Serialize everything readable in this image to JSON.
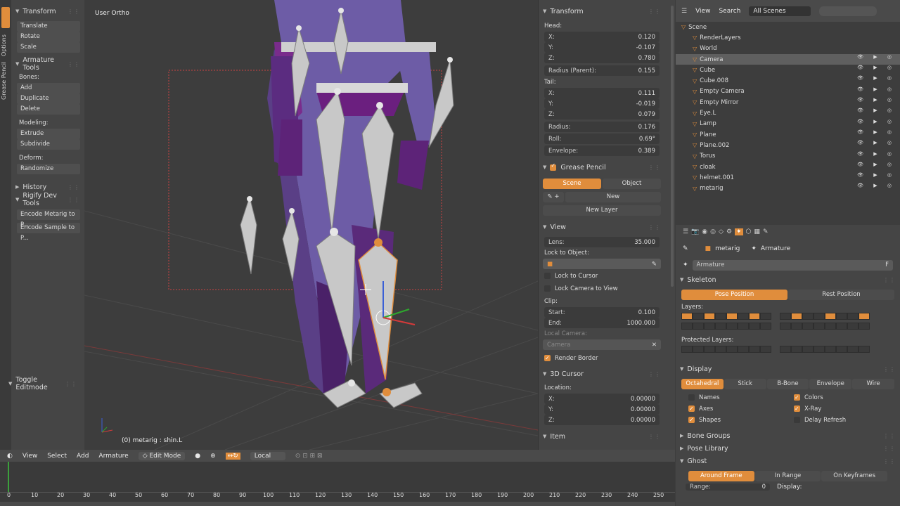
{
  "toolshelf": {
    "tabs": [
      "Tools",
      "Options",
      "Grease Pencil"
    ],
    "transform": {
      "title": "Transform",
      "items": [
        "Translate",
        "Rotate",
        "Scale"
      ]
    },
    "armature_tools": {
      "title": "Armature Tools",
      "bones_label": "Bones:",
      "bones": [
        "Add",
        "Duplicate",
        "Delete"
      ],
      "modeling_label": "Modeling:",
      "modeling": [
        "Extrude",
        "Subdivide"
      ],
      "deform_label": "Deform:",
      "deform": [
        "Randomize"
      ]
    },
    "history": "History",
    "rigify": {
      "title": "Rigify Dev Tools",
      "items": [
        "Encode Metarig to P...",
        "Encode Sample to P..."
      ]
    },
    "toggle": "Toggle Editmode"
  },
  "viewport": {
    "view_name": "User Ortho",
    "status": "(0) metarig : shin.L"
  },
  "properties_n": {
    "transform_title": "Transform",
    "head_label": "Head:",
    "head": [
      {
        "k": "X:",
        "v": "0.120"
      },
      {
        "k": "Y:",
        "v": "-0.107"
      },
      {
        "k": "Z:",
        "v": "0.780"
      }
    ],
    "radius_parent": {
      "k": "Radius (Parent):",
      "v": "0.155"
    },
    "tail_label": "Tail:",
    "tail": [
      {
        "k": "X:",
        "v": "0.111"
      },
      {
        "k": "Y:",
        "v": "-0.019"
      },
      {
        "k": "Z:",
        "v": "0.079"
      }
    ],
    "radius": {
      "k": "Radius:",
      "v": "0.176"
    },
    "roll": {
      "k": "Roll:",
      "v": "0.69°"
    },
    "envelope": {
      "k": "Envelope:",
      "v": "0.389"
    },
    "grease_title": "Grease Pencil",
    "scene_btn": "Scene",
    "object_btn": "Object",
    "new_btn": "New",
    "new_layer_btn": "New Layer",
    "view_title": "View",
    "lens": {
      "k": "Lens:",
      "v": "35.000"
    },
    "lock_to_object": "Lock to Object:",
    "lock_to_cursor": "Lock to Cursor",
    "lock_camera": "Lock Camera to View",
    "clip_label": "Clip:",
    "clip_start": {
      "k": "Start:",
      "v": "0.100"
    },
    "clip_end": {
      "k": "End:",
      "v": "1000.000"
    },
    "local_camera": "Local Camera:",
    "camera_field": "Camera",
    "render_border": "Render Border",
    "cursor_title": "3D Cursor",
    "location_label": "Location:",
    "cursor": [
      {
        "k": "X:",
        "v": "0.00000"
      },
      {
        "k": "Y:",
        "v": "0.00000"
      },
      {
        "k": "Z:",
        "v": "0.00000"
      }
    ],
    "item_title": "Item"
  },
  "outliner": {
    "menu": [
      "View",
      "Search"
    ],
    "scene_select": "All Scenes",
    "items": [
      {
        "name": "Scene",
        "depth": 0
      },
      {
        "name": "RenderLayers",
        "depth": 1
      },
      {
        "name": "World",
        "depth": 1
      },
      {
        "name": "Camera",
        "depth": 1,
        "sel": true
      },
      {
        "name": "Cube",
        "depth": 1
      },
      {
        "name": "Cube.008",
        "depth": 1
      },
      {
        "name": "Empty Camera",
        "depth": 1
      },
      {
        "name": "Empty Mirror",
        "depth": 1
      },
      {
        "name": "Eye.L",
        "depth": 1
      },
      {
        "name": "Lamp",
        "depth": 1
      },
      {
        "name": "Plane",
        "depth": 1
      },
      {
        "name": "Plane.002",
        "depth": 1
      },
      {
        "name": "Torus",
        "depth": 1
      },
      {
        "name": "cloak",
        "depth": 1
      },
      {
        "name": "helmet.001",
        "depth": 1
      },
      {
        "name": "metarig",
        "depth": 1
      }
    ]
  },
  "props": {
    "breadcrumb": [
      "metarig",
      "Armature"
    ],
    "data_name": "Armature",
    "data_flag": "F",
    "skeleton_title": "Skeleton",
    "pose_position": "Pose Position",
    "rest_position": "Rest Position",
    "layers_label": "Layers:",
    "protected_label": "Protected Layers:",
    "display_title": "Display",
    "display_tabs": [
      "Octahedral",
      "Stick",
      "B-Bone",
      "Envelope",
      "Wire"
    ],
    "names": "Names",
    "colors": "Colors",
    "axes": "Axes",
    "xray": "X-Ray",
    "shapes": "Shapes",
    "delay": "Delay Refresh",
    "bone_groups": "Bone Groups",
    "pose_library": "Pose Library",
    "ghost": "Ghost",
    "ghost_tabs": [
      "Around Frame",
      "In Range",
      "On Keyframes"
    ],
    "range": "Range:",
    "range_val": "0",
    "display_label": "Display:"
  },
  "header3d": {
    "menus": [
      "View",
      "Select",
      "Add",
      "Armature"
    ],
    "mode": "Edit Mode",
    "pivot": "Local"
  },
  "timeline": {
    "ticks": [
      "0",
      "10",
      "20",
      "30",
      "40",
      "50",
      "60",
      "70",
      "80",
      "90",
      "100",
      "110",
      "120",
      "130",
      "140",
      "150",
      "160",
      "170",
      "180",
      "190",
      "200",
      "210",
      "220",
      "230",
      "240",
      "250"
    ]
  },
  "colors": {
    "accent": "#e08d3c",
    "panel": "#454545",
    "viewport": "#3d3d3d"
  }
}
